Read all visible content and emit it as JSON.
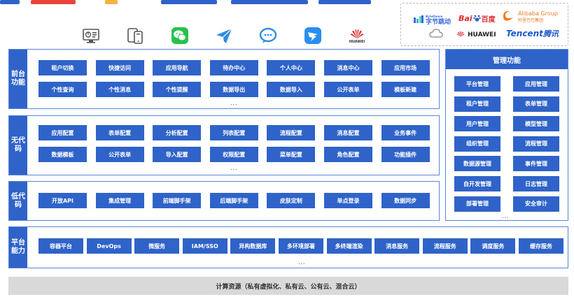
{
  "top_strip_colors": [
    "#2f63c9",
    "#e8443a",
    "#f3b23c",
    "#2f63c9",
    "#2f63c9",
    "#2f63c9"
  ],
  "clients": [
    {
      "icon": "dashboard-terminal-icon"
    },
    {
      "icon": "mobile-tablet-icon"
    },
    {
      "icon": "wechat-icon"
    },
    {
      "icon": "paper-plane-icon"
    },
    {
      "icon": "chat-bubble-icon"
    },
    {
      "icon": "dingtalk-icon"
    },
    {
      "icon": "huawei-logo-icon",
      "caption": "HUAWEI"
    }
  ],
  "partners": {
    "bytedance": {
      "small": "ByteDance",
      "name": "字节跳动",
      "color": "#3d6bd8"
    },
    "baidu": {
      "name": "Bai",
      "cn": "百度",
      "color": "#2f63c9"
    },
    "alibaba": {
      "name": "Alibaba Group",
      "cn": "阿里巴巴集团",
      "color": "#f07c22"
    },
    "cloud": {
      "icon": "cloud-icon"
    },
    "huawei": {
      "name": "HUAWEI",
      "color": "#222222"
    },
    "tencent": {
      "name": "Tencent",
      "cn": "腾讯",
      "color": "#1c58c9"
    }
  },
  "frontend": {
    "label": "前台功能",
    "rows": [
      [
        "租户切换",
        "快捷访问",
        "应用导航",
        "待办中心",
        "个人中心",
        "消息中心",
        "应用市场"
      ],
      [
        "个性查询",
        "个性消息",
        "个性提醒",
        "数据导出",
        "数据导入",
        "公开表单",
        "模板新建"
      ]
    ],
    "more": "..."
  },
  "nocode": {
    "label": "无代码",
    "rows": [
      [
        "应用配置",
        "表单配置",
        "分析配置",
        "列表配置",
        "流程配置",
        "消息配置",
        "业务事件"
      ],
      [
        "数据模板",
        "公开表单",
        "导入配置",
        "权限配置",
        "菜单配置",
        "角色配置",
        "功能插件"
      ]
    ],
    "more": "..."
  },
  "lowcode": {
    "label": "低代码",
    "rows": [
      [
        "开放API",
        "集成管理",
        "前端脚手架",
        "后端脚手架",
        "皮肤定制",
        "单点登录",
        "数据同步"
      ]
    ]
  },
  "platform": {
    "label": "平台能力",
    "items": [
      "容器平台",
      "DevOps",
      "微服务",
      "IAM/SSO",
      "异构数据库",
      "多环境部署",
      "多终端渲染",
      "消息服务",
      "流程服务",
      "调度服务",
      "缓存服务"
    ],
    "more": "..."
  },
  "management": {
    "title": "管理功能",
    "items": [
      "平台管理",
      "应用管理",
      "租户管理",
      "表单管理",
      "用户管理",
      "模型管理",
      "组织管理",
      "流程管理",
      "数据源管理",
      "事件管理",
      "自开发管理",
      "日志管理",
      "部署管理",
      "安全审计"
    ],
    "more": "..."
  },
  "compute": "计算资源（私有虚拟化、私有云、公有云、混合云）"
}
